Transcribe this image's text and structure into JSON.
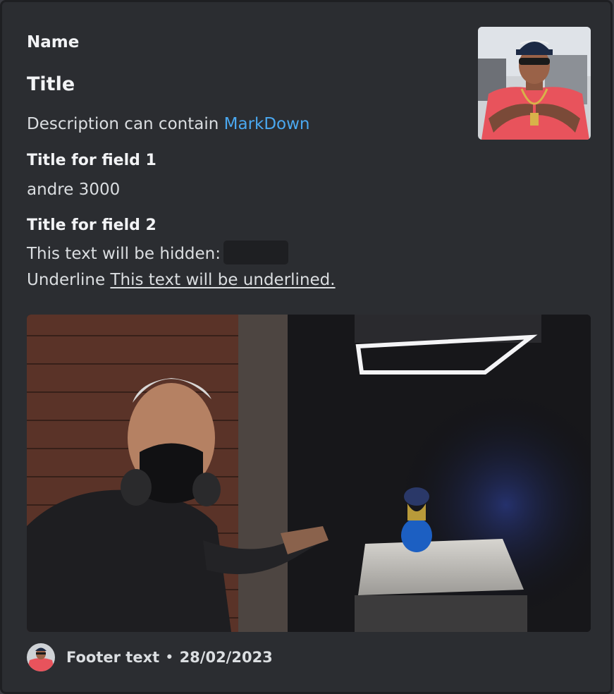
{
  "embed": {
    "author_name": "Name",
    "title": "Title",
    "description_prefix": "Description can contain ",
    "description_link": "MarkDown",
    "thumbnail_icon": "portrait-photo-icon",
    "fields": [
      {
        "name": "Title for field 1",
        "value": "andre 3000"
      },
      {
        "name": "Title for field 2",
        "hidden_prefix": "This text will be hidden:",
        "underline_prefix": "Underline ",
        "underline_text": "This text will be underlined."
      }
    ],
    "image_icon": "game-screenshot-icon",
    "footer": {
      "icon": "portrait-photo-icon",
      "text": "Footer text",
      "separator": "•",
      "timestamp": "28/02/2023"
    }
  },
  "colors": {
    "background": "#2b2d31",
    "link": "#4aa8f0",
    "spoiler": "#1e1f22"
  }
}
